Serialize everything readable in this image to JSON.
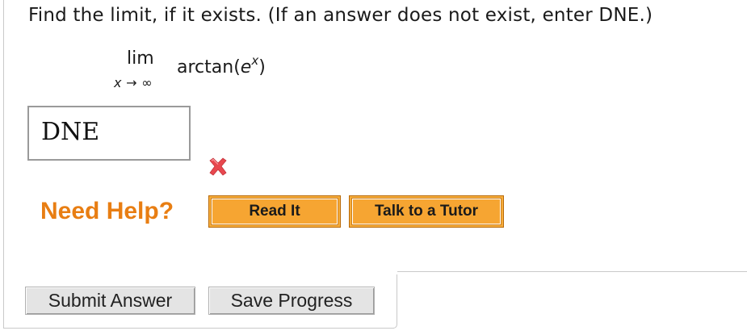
{
  "question": {
    "prompt": "Find the limit, if it exists. (If an answer does not exist, enter DNE.)"
  },
  "limit": {
    "operator": "lim",
    "subscript_var": "x",
    "subscript_arrow": "→",
    "subscript_target": "∞",
    "function_prefix": "arctan(",
    "base": "e",
    "exponent": "x",
    "function_suffix": ")"
  },
  "answer": {
    "value": "DNE",
    "status": "incorrect",
    "status_icon": "x-mark-icon",
    "status_color": "#e8484f"
  },
  "help": {
    "label": "Need Help?",
    "label_color": "#e87e13",
    "read_it_label": "Read It",
    "talk_tutor_label": "Talk to a Tutor",
    "button_color": "#f6a532"
  },
  "actions": {
    "submit_label": "Submit Answer",
    "save_label": "Save Progress"
  }
}
